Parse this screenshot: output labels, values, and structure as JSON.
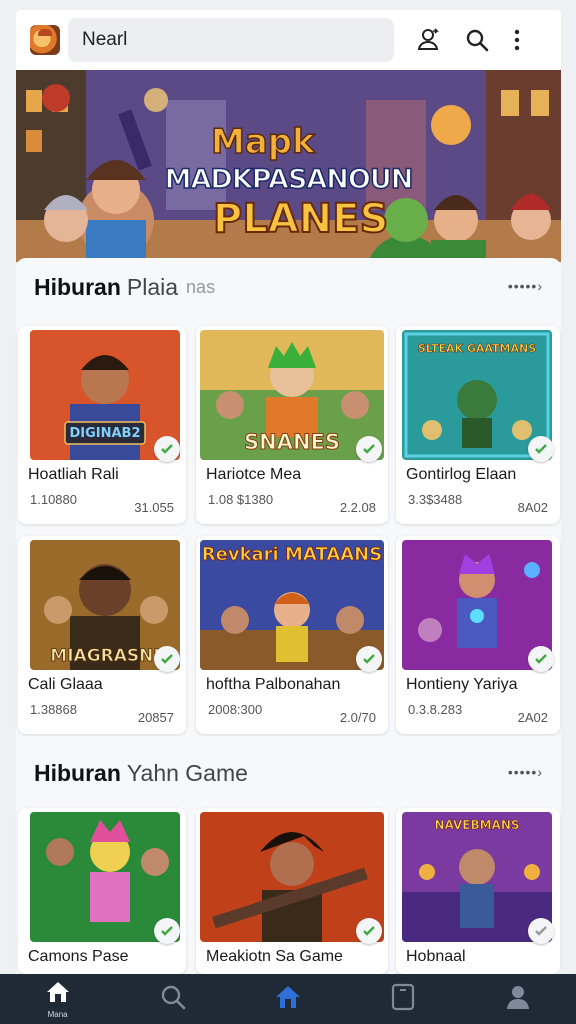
{
  "header": {
    "search_value": "Nearl",
    "icons": [
      "app-logo",
      "user-switch-icon",
      "search-icon",
      "more-vertical-icon"
    ]
  },
  "banner": {
    "line1": "Mapk",
    "line2": "MADKPASANOUN",
    "line3": "PLANES"
  },
  "sections": [
    {
      "title_bold": "Hiburan",
      "title_rest": "Plaia",
      "title_faint": "nas",
      "more": "•••••›",
      "cards": [
        {
          "thumb_caption": "DIGINAB2",
          "title": "Hoatliah Rali",
          "meta_left": "1.10880",
          "meta_right": "31.055"
        },
        {
          "thumb_caption": "SNANES",
          "title": "Hariotce Mea",
          "meta_left": "1.08 $1380",
          "meta_right": "2.2.08"
        },
        {
          "thumb_caption": "SLTEAK GAATMANS",
          "title": "Gontirlog Elaan",
          "meta_left": "3.3$3488",
          "meta_right": "8A02"
        },
        {
          "thumb_caption": "MIAGRASNI",
          "title": "Cali Glaaa",
          "meta_left": "1.38868",
          "meta_right": "20857"
        },
        {
          "thumb_caption": "Revkari MATAANS",
          "title": "hoftha Palbonahan",
          "meta_left": "2008:300",
          "meta_right": "2.0/70"
        },
        {
          "thumb_caption": "",
          "title": "Hontieny Yariya",
          "meta_left": "0.3.8.283",
          "meta_right": "2A02"
        }
      ]
    },
    {
      "title_bold": "Hiburan",
      "title_rest": "Yahn Game",
      "title_faint": "",
      "more": "•••••›",
      "cards": [
        {
          "thumb_caption": "",
          "title": "Camons Pase"
        },
        {
          "thumb_caption": "",
          "title": "Meakiotn Sa Game"
        },
        {
          "thumb_caption": "NAVEBMANS",
          "title": "Hobnaal"
        }
      ]
    }
  ],
  "bottom_nav": {
    "items": [
      {
        "icon": "home-icon",
        "label": "Mana",
        "active": true
      },
      {
        "icon": "search-icon",
        "label": ""
      },
      {
        "icon": "home-outline-icon",
        "label": ""
      },
      {
        "icon": "tablet-icon",
        "label": ""
      },
      {
        "icon": "profile-icon",
        "label": ""
      }
    ]
  },
  "colors": {
    "nav_bg": "#1f2a36",
    "accent_blue": "#2d6fd6",
    "check_green": "#3faa3f"
  }
}
